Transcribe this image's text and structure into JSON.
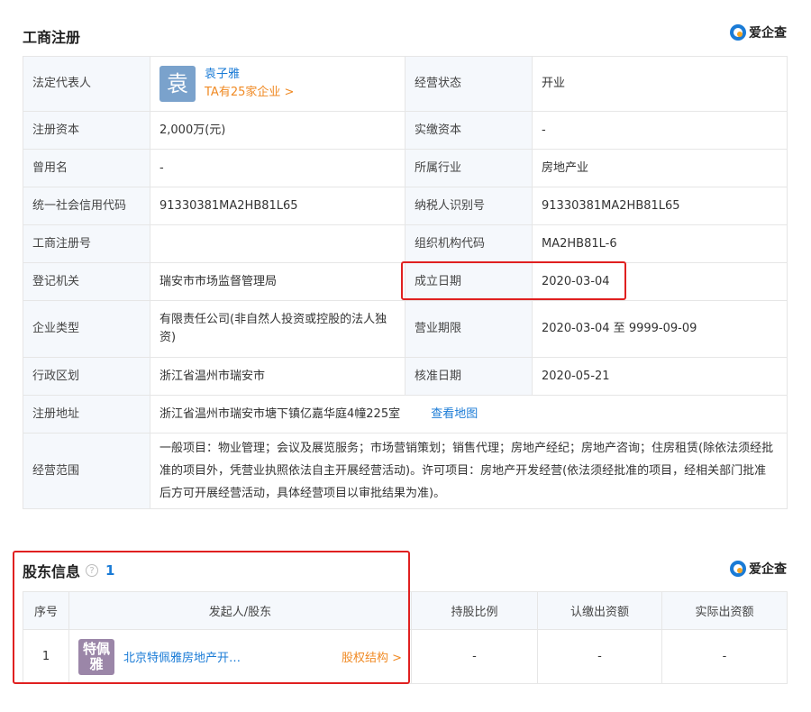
{
  "registration": {
    "title": "工商注册",
    "brand": "爱企查",
    "legal_rep_label": "法定代表人",
    "legal_rep_avatar": "袁",
    "legal_rep_name": "袁子雅",
    "legal_rep_link": "TA有25家企业 >",
    "status_label": "经营状态",
    "status_value": "开业",
    "reg_capital_label": "注册资本",
    "reg_capital_value": "2,000万(元)",
    "paid_capital_label": "实缴资本",
    "paid_capital_value": "-",
    "former_name_label": "曾用名",
    "former_name_value": "-",
    "industry_label": "所属行业",
    "industry_value": "房地产业",
    "credit_code_label": "统一社会信用代码",
    "credit_code_value": "91330381MA2HB81L65",
    "taxpayer_label": "纳税人识别号",
    "taxpayer_value": "91330381MA2HB81L65",
    "reg_no_label": "工商注册号",
    "reg_no_value": "",
    "org_code_label": "组织机构代码",
    "org_code_value": "MA2HB81L-6",
    "authority_label": "登记机关",
    "authority_value": "瑞安市市场监督管理局",
    "established_label": "成立日期",
    "established_value": "2020-03-04",
    "type_label": "企业类型",
    "type_value": "有限责任公司(非自然人投资或控股的法人独资)",
    "term_label": "营业期限",
    "term_value": "2020-03-04 至 9999-09-09",
    "region_label": "行政区划",
    "region_value": "浙江省温州市瑞安市",
    "approval_label": "核准日期",
    "approval_value": "2020-05-21",
    "address_label": "注册地址",
    "address_value": "浙江省温州市瑞安市塘下镇亿嘉华庭4幢225室",
    "map_link": "查看地图",
    "scope_label": "经营范围",
    "scope_value": "一般项目：物业管理；会议及展览服务；市场营销策划；销售代理；房地产经纪；房地产咨询；住房租赁(除依法须经批准的项目外，凭营业执照依法自主开展经营活动)。许可项目：房地产开发经营(依法须经批准的项目，经相关部门批准后方可开展经营活动，具体经营项目以审批结果为准)。"
  },
  "shareholders": {
    "title": "股东信息",
    "help_icon": "?",
    "count": "1",
    "brand": "爱企查",
    "headers": [
      "序号",
      "发起人/股东",
      "持股比例",
      "认缴出资额",
      "实际出资额"
    ],
    "rows": [
      {
        "index": "1",
        "avatar": "特佩雅",
        "name": "北京特佩雅房地产开…",
        "link": "股权结构 >",
        "ratio": "-",
        "subscribed": "-",
        "paid": "-"
      }
    ]
  }
}
